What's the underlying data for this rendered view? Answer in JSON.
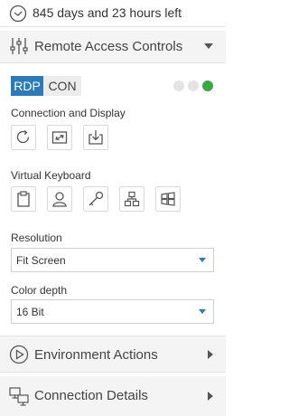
{
  "timer": {
    "text": "845 days and 23 hours left",
    "icon": "clock-icon"
  },
  "remote_access": {
    "title": "Remote Access Controls",
    "tabs": [
      {
        "label": "RDP",
        "active": true
      },
      {
        "label": "CON",
        "active": false
      }
    ],
    "status_dots": [
      "#e3e3e3",
      "#e3e3e3",
      "#39a845"
    ],
    "connection_display": {
      "label": "Connection and Display",
      "buttons": [
        "refresh-icon",
        "fullscreen-icon",
        "download-icon"
      ]
    },
    "virtual_keyboard": {
      "label": "Virtual Keyboard",
      "buttons": [
        "clipboard-icon",
        "user-icon",
        "key-icon",
        "network-icon",
        "windows-icon"
      ]
    },
    "resolution": {
      "label": "Resolution",
      "value": "Fit Screen"
    },
    "color_depth": {
      "label": "Color depth",
      "value": "16 Bit"
    }
  },
  "environment_actions": {
    "title": "Environment Actions"
  },
  "connection_details": {
    "title": "Connection Details"
  },
  "colors": {
    "accent": "#2e7ab7",
    "status_green": "#39a845",
    "header_bg": "#f4f4f4"
  }
}
